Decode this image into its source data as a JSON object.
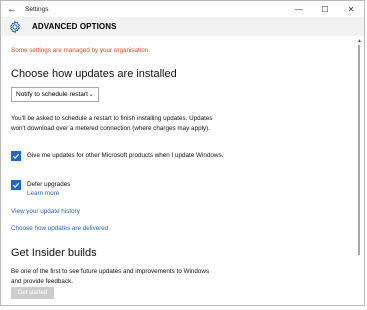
{
  "window": {
    "title": "Settings",
    "back_glyph": "←",
    "minimize_glyph": "—",
    "maximize_glyph": "☐",
    "close_glyph": "✕"
  },
  "header": {
    "title": "ADVANCED OPTIONS",
    "icon": "gear-icon"
  },
  "managed_notice": "Some settings are managed by your organisation.",
  "updates": {
    "heading": "Choose how updates are installed",
    "dropdown_value": "Notify to schedule restart",
    "description": "You'll be asked to schedule a restart to finish installing updates. Updates won't download over a metered connection (where charges may apply).",
    "other_products": {
      "checked": true,
      "label": "Give me updates for other Microsoft products when I update Windows."
    },
    "defer": {
      "checked": true,
      "label": "Defer upgrades",
      "learn_more": "Learn more"
    },
    "history_link": "View your update history",
    "delivery_link": "Choose how updates are delivered"
  },
  "insider": {
    "heading": "Get Insider builds",
    "description": "Be one of the first to see future updates and improvements to Windows and provide feedback.",
    "button_label": "Get started"
  },
  "colors": {
    "accent": "#1f64c8",
    "link": "#2466bf",
    "warning": "#d64c1c"
  }
}
